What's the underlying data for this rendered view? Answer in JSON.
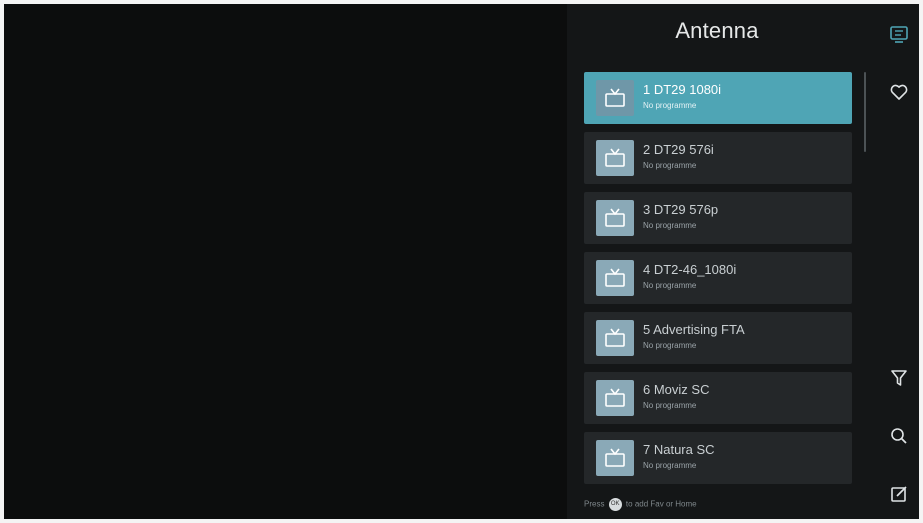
{
  "panel": {
    "title": "Antenna"
  },
  "channels": [
    {
      "name": "1 DT29 1080i",
      "subtitle": "No programme",
      "selected": true
    },
    {
      "name": "2 DT29 576i",
      "subtitle": "No programme",
      "selected": false
    },
    {
      "name": "3 DT29 576p",
      "subtitle": "No programme",
      "selected": false
    },
    {
      "name": "4 DT2-46_1080i",
      "subtitle": "No programme",
      "selected": false
    },
    {
      "name": "5 Advertising FTA",
      "subtitle": "No programme",
      "selected": false
    },
    {
      "name": "6 Moviz SC",
      "subtitle": "No programme",
      "selected": false
    },
    {
      "name": "7 Natura SC",
      "subtitle": "No programme",
      "selected": false
    }
  ],
  "hint": {
    "before": "Press",
    "button": "OK",
    "after": "to add Fav or Home"
  },
  "side_icons": [
    {
      "name": "channel-list-icon"
    },
    {
      "name": "favourite-heart-icon"
    },
    {
      "name": "filter-icon"
    },
    {
      "name": "search-icon"
    },
    {
      "name": "edit-icon"
    }
  ],
  "colors": {
    "accent": "#4fa5b5",
    "panel_bg": "#141617",
    "item_bg": "#242729"
  }
}
